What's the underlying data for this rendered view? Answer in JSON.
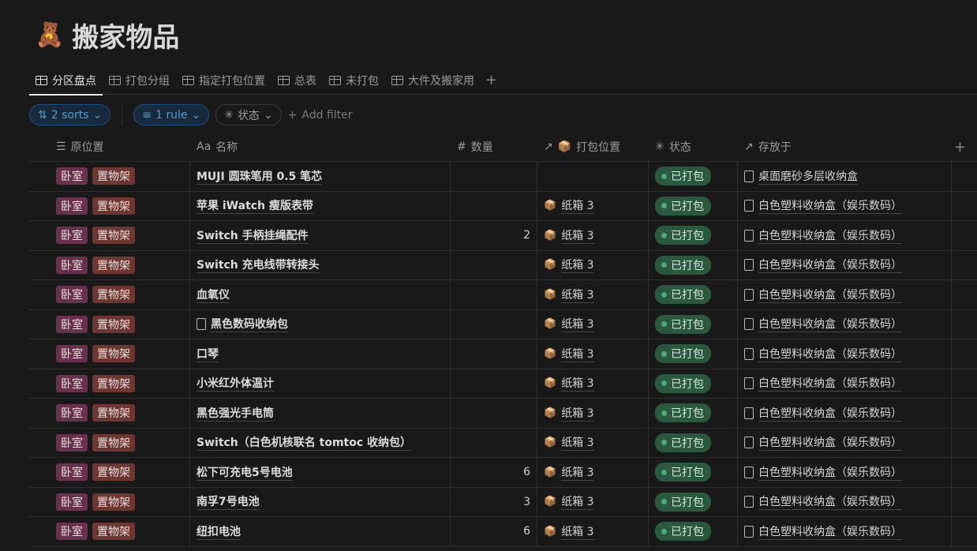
{
  "page": {
    "emoji": "🧸",
    "title": "搬家物品"
  },
  "tabs": [
    "分区盘点",
    "打包分组",
    "指定打包位置",
    "总表",
    "未打包",
    "大件及搬家用"
  ],
  "filters": {
    "sorts": "2 sorts",
    "rule": "1 rule",
    "status": "状态",
    "add_filter": "Add filter"
  },
  "columns": {
    "location": "原位置",
    "name": "名称",
    "qty": "数量",
    "pack": "打包位置",
    "status": "状态",
    "stored": "存放于"
  },
  "rows": [
    {
      "tags": [
        "卧室",
        "置物架"
      ],
      "name": "MUJI 圆珠笔用 0.5 笔芯",
      "qty": "",
      "pack": "",
      "status": "已打包",
      "stored": "桌面磨砂多层收纳盒"
    },
    {
      "tags": [
        "卧室",
        "置物架"
      ],
      "name": "苹果 iWatch 瘦版表带",
      "qty": "",
      "pack": "纸箱 3",
      "status": "已打包",
      "stored": "白色塑料收纳盒（娱乐数码）"
    },
    {
      "tags": [
        "卧室",
        "置物架"
      ],
      "name": "Switch 手柄挂绳配件",
      "qty": "2",
      "pack": "纸箱 3",
      "status": "已打包",
      "stored": "白色塑料收纳盒（娱乐数码）"
    },
    {
      "tags": [
        "卧室",
        "置物架"
      ],
      "name": "Switch 充电线带转接头",
      "qty": "",
      "pack": "纸箱 3",
      "status": "已打包",
      "stored": "白色塑料收纳盒（娱乐数码）"
    },
    {
      "tags": [
        "卧室",
        "置物架"
      ],
      "name": "血氧仪",
      "qty": "",
      "pack": "纸箱 3",
      "status": "已打包",
      "stored": "白色塑料收纳盒（娱乐数码）"
    },
    {
      "tags": [
        "卧室",
        "置物架"
      ],
      "name": "黑色数码收纳包",
      "qty": "",
      "pack": "纸箱 3",
      "status": "已打包",
      "stored": "白色塑料收纳盒（娱乐数码）",
      "doc": true
    },
    {
      "tags": [
        "卧室",
        "置物架"
      ],
      "name": "口琴",
      "qty": "",
      "pack": "纸箱 3",
      "status": "已打包",
      "stored": "白色塑料收纳盒（娱乐数码）"
    },
    {
      "tags": [
        "卧室",
        "置物架"
      ],
      "name": "小米红外体温计",
      "qty": "",
      "pack": "纸箱 3",
      "status": "已打包",
      "stored": "白色塑料收纳盒（娱乐数码）"
    },
    {
      "tags": [
        "卧室",
        "置物架"
      ],
      "name": "黑色强光手电筒",
      "qty": "",
      "pack": "纸箱 3",
      "status": "已打包",
      "stored": "白色塑料收纳盒（娱乐数码）"
    },
    {
      "tags": [
        "卧室",
        "置物架"
      ],
      "name": "Switch（白色机核联名 tomtoc 收纳包）",
      "qty": "",
      "pack": "纸箱 3",
      "status": "已打包",
      "stored": "白色塑料收纳盒（娱乐数码）"
    },
    {
      "tags": [
        "卧室",
        "置物架"
      ],
      "name": "松下可充电5号电池",
      "qty": "6",
      "pack": "纸箱 3",
      "status": "已打包",
      "stored": "白色塑料收纳盒（娱乐数码）"
    },
    {
      "tags": [
        "卧室",
        "置物架"
      ],
      "name": "南孚7号电池",
      "qty": "3",
      "pack": "纸箱 3",
      "status": "已打包",
      "stored": "白色塑料收纳盒（娱乐数码）"
    },
    {
      "tags": [
        "卧室",
        "置物架"
      ],
      "name": "纽扣电池",
      "qty": "6",
      "pack": "纸箱 3",
      "status": "已打包",
      "stored": "白色塑料收纳盒（娱乐数码）"
    }
  ]
}
